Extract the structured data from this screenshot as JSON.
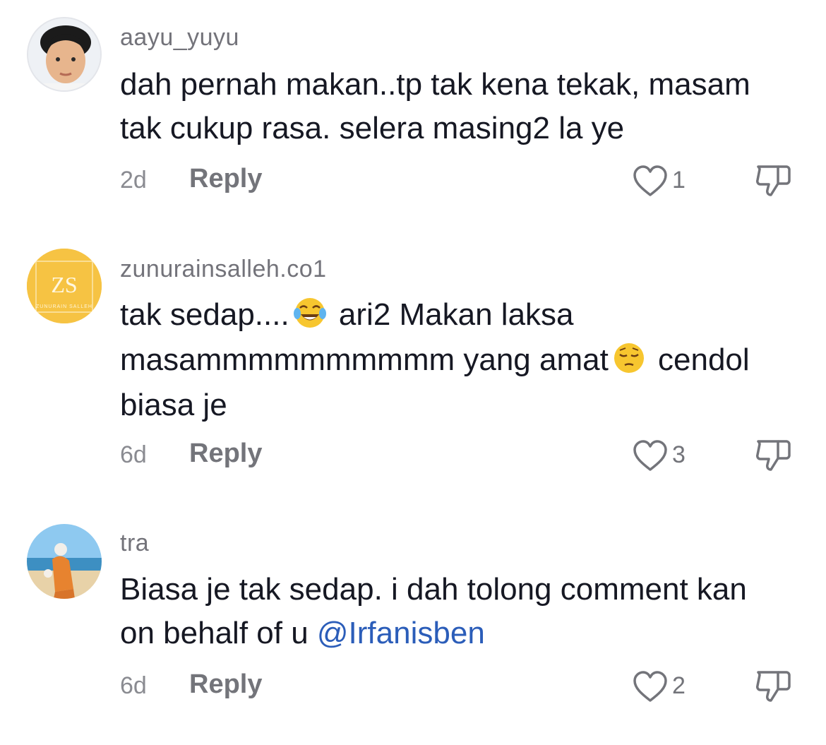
{
  "comments": [
    {
      "username": "aayu_yuyu",
      "text_line1": "dah pernah makan..tp tak kena tekak, masam",
      "text_line2": "tak cukup rasa. selera masing2 la ye",
      "time": "2d",
      "reply_label": "Reply",
      "like_count": "1",
      "avatar_icon": "child-photo-avatar"
    },
    {
      "username": "zunurainsalleh.co1",
      "text_part1": "tak sedap....",
      "emoji1": "face-with-tears-of-joy",
      "text_part2": " ari2 Makan laksa",
      "text_part3": "masammmmmmmmmm yang amat",
      "emoji2": "pensive-face",
      "text_part4": " cendol",
      "text_part5": "biasa je",
      "time": "6d",
      "reply_label": "Reply",
      "like_count": "3",
      "avatar_text": "ZS",
      "avatar_subtext": "ZUNURAIN SALLEH",
      "avatar_color": "#f6c343"
    },
    {
      "username": "tra",
      "text_line1": "Biasa je tak sedap. i dah tolong comment kan",
      "text_part_on": "on behalf of u ",
      "mention": "@Irfanisben",
      "time": "6d",
      "reply_label": "Reply",
      "like_count": "2",
      "avatar_icon": "beach-photo-avatar"
    }
  ],
  "colors": {
    "username": "#73737a",
    "text": "#161823",
    "mention": "#2b5db9",
    "meta": "#8a8b91"
  }
}
